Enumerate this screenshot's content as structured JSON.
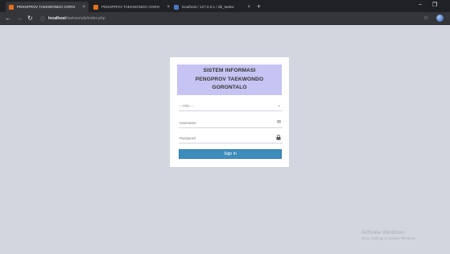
{
  "browser": {
    "tabs": [
      {
        "title": "PENGPROV TAEKWONDO GORO",
        "active": true
      },
      {
        "title": "PENGPROV TAEKWONDO GORO",
        "active": false
      },
      {
        "title": "localhost / 127.0.0.1 / db_taekw",
        "active": false
      }
    ],
    "url_host": "localhost",
    "url_path": "/taekwondo/index.php"
  },
  "login": {
    "header_line1": "SISTEM INFORMASI",
    "header_line2": "PENGPROV TAEKWONDO",
    "header_line3": "GORONTALO",
    "select_value": "-- Pilih --",
    "username_placeholder": "Username",
    "password_placeholder": "Password",
    "signin_label": "Sign In",
    "header_color": "#c6c4f2",
    "button_color": "#3c8dbc"
  },
  "watermark": {
    "line1": "Activate Windows",
    "line2": "Go to Settings to activate Windows."
  }
}
